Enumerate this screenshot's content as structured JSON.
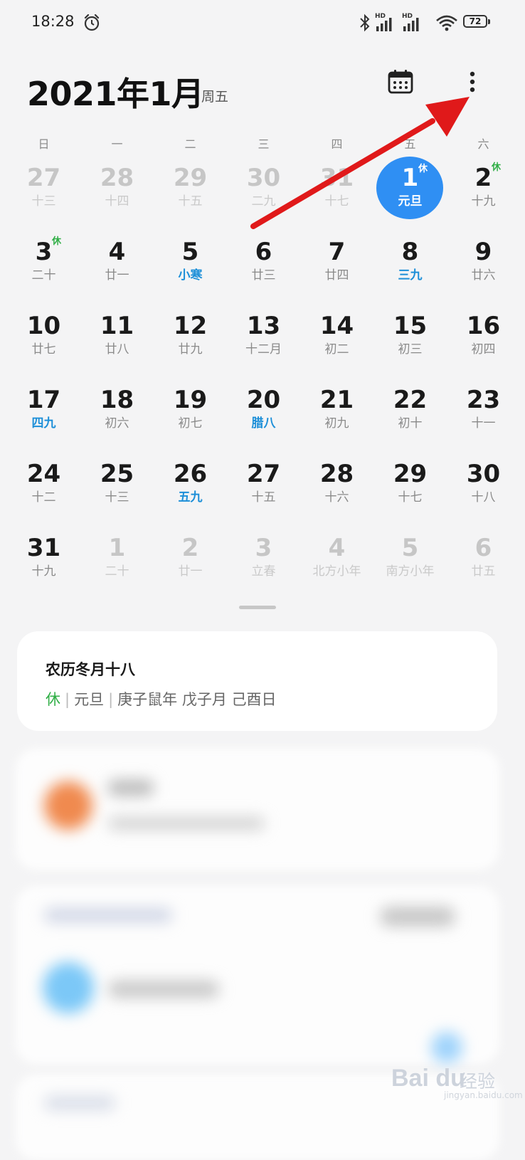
{
  "status_bar": {
    "time": "18:28",
    "battery": "72",
    "hd_label": "HD"
  },
  "header": {
    "title": "2021年1月",
    "weekday": "周五"
  },
  "weekdays": [
    "日",
    "一",
    "二",
    "三",
    "四",
    "五",
    "六"
  ],
  "weeks": [
    [
      {
        "day": "27",
        "lunar": "十三",
        "other": true
      },
      {
        "day": "28",
        "lunar": "十四",
        "other": true
      },
      {
        "day": "29",
        "lunar": "十五",
        "other": true
      },
      {
        "day": "30",
        "lunar": "二九",
        "other": true
      },
      {
        "day": "31",
        "lunar": "十七",
        "other": true
      },
      {
        "day": "1",
        "lunar": "元旦",
        "selected": true,
        "badge": "休"
      },
      {
        "day": "2",
        "lunar": "十九",
        "badge": "休"
      }
    ],
    [
      {
        "day": "3",
        "lunar": "二十",
        "badge": "休"
      },
      {
        "day": "4",
        "lunar": "廿一"
      },
      {
        "day": "5",
        "lunar": "小寒",
        "term": true
      },
      {
        "day": "6",
        "lunar": "廿三"
      },
      {
        "day": "7",
        "lunar": "廿四"
      },
      {
        "day": "8",
        "lunar": "三九",
        "term": true
      },
      {
        "day": "9",
        "lunar": "廿六"
      }
    ],
    [
      {
        "day": "10",
        "lunar": "廿七"
      },
      {
        "day": "11",
        "lunar": "廿八"
      },
      {
        "day": "12",
        "lunar": "廿九"
      },
      {
        "day": "13",
        "lunar": "十二月"
      },
      {
        "day": "14",
        "lunar": "初二"
      },
      {
        "day": "15",
        "lunar": "初三"
      },
      {
        "day": "16",
        "lunar": "初四"
      }
    ],
    [
      {
        "day": "17",
        "lunar": "四九",
        "term": true
      },
      {
        "day": "18",
        "lunar": "初六"
      },
      {
        "day": "19",
        "lunar": "初七"
      },
      {
        "day": "20",
        "lunar": "腊八",
        "term": true
      },
      {
        "day": "21",
        "lunar": "初九"
      },
      {
        "day": "22",
        "lunar": "初十"
      },
      {
        "day": "23",
        "lunar": "十一"
      }
    ],
    [
      {
        "day": "24",
        "lunar": "十二"
      },
      {
        "day": "25",
        "lunar": "十三"
      },
      {
        "day": "26",
        "lunar": "五九",
        "term": true
      },
      {
        "day": "27",
        "lunar": "十五"
      },
      {
        "day": "28",
        "lunar": "十六"
      },
      {
        "day": "29",
        "lunar": "十七"
      },
      {
        "day": "30",
        "lunar": "十八"
      }
    ],
    [
      {
        "day": "31",
        "lunar": "十九"
      },
      {
        "day": "1",
        "lunar": "二十",
        "other": true
      },
      {
        "day": "2",
        "lunar": "廿一",
        "other": true
      },
      {
        "day": "3",
        "lunar": "立春",
        "other": true
      },
      {
        "day": "4",
        "lunar": "北方小年",
        "other": true
      },
      {
        "day": "5",
        "lunar": "南方小年",
        "other": true
      },
      {
        "day": "6",
        "lunar": "廿五",
        "other": true
      }
    ]
  ],
  "info_card": {
    "title": "农历冬月十八",
    "rest": "休",
    "holiday": "元旦",
    "ganzhi": "庚子鼠年 戊子月 己酉日"
  },
  "watermark": {
    "logo": "Bai du",
    "jingyan": "经验",
    "url": "jingyan.baidu.com"
  },
  "colors": {
    "accent": "#2f8ff3",
    "term": "#1d8fd8",
    "rest": "#2fae45",
    "annotation_arrow": "#e0191a"
  }
}
